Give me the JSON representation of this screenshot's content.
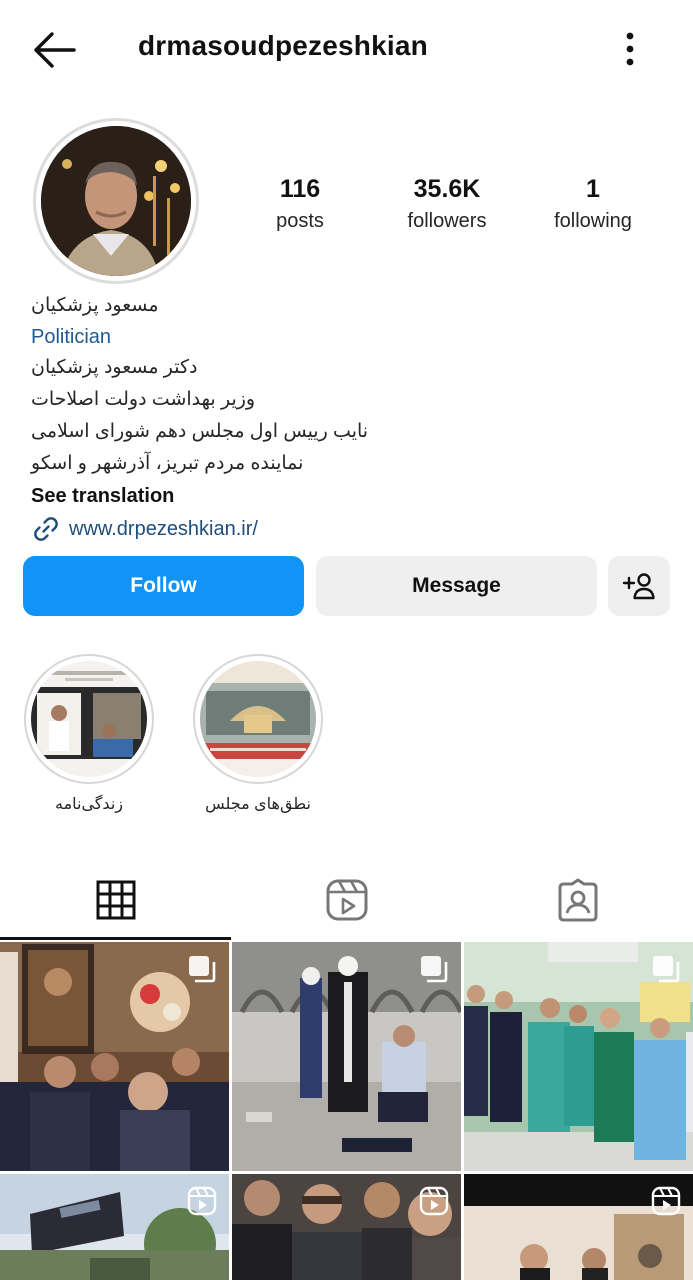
{
  "header": {
    "username": "drmasoudpezeshkian"
  },
  "profile": {
    "stats": [
      {
        "value": "116",
        "label": "posts"
      },
      {
        "value": "35.6K",
        "label": "followers"
      },
      {
        "value": "1",
        "label": "following"
      }
    ],
    "name": "مسعود پزشکیان",
    "category": "Politician",
    "bio_lines": [
      "دکتر مسعود پزشکیان",
      "وزیر بهداشت دولت اصلاحات",
      "نایب رییس اول مجلس دهم شورای اسلامی",
      "نماینده مردم تبریز، آذرشهر و اسکو"
    ],
    "see_translation": "See translation",
    "website": "www.drpezeshkian.ir/"
  },
  "actions": {
    "follow": "Follow",
    "message": "Message"
  },
  "highlights": [
    {
      "label": "زندگی‌نامه"
    },
    {
      "label": "نطق‌های مجلس"
    }
  ],
  "tabs": [
    {
      "icon": "grid-icon",
      "active": true
    },
    {
      "icon": "reels-icon",
      "active": false
    },
    {
      "icon": "tagged-icon",
      "active": false
    }
  ],
  "posts": [
    {
      "badge": "carousel-icon"
    },
    {
      "badge": "carousel-icon"
    },
    {
      "badge": "carousel-icon"
    },
    {
      "badge": "reel-icon"
    },
    {
      "badge": "reel-icon"
    },
    {
      "badge": "reel-icon"
    }
  ],
  "colors": {
    "follow_blue": "#1294f6",
    "link_blue": "#1f4d7c",
    "button_gray": "#efefef"
  }
}
